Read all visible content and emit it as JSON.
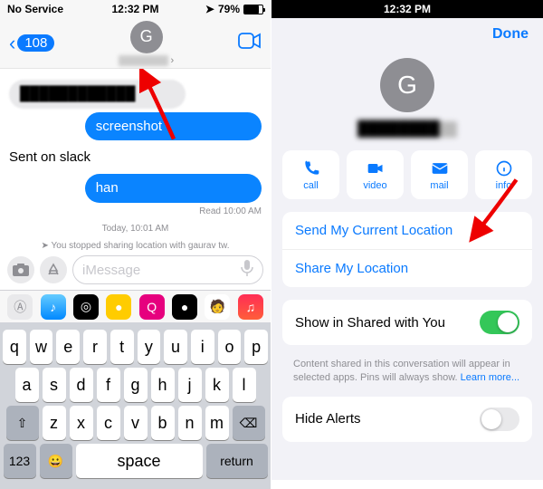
{
  "status": {
    "carrier": "No Service",
    "time": "12:32 PM",
    "pct": "79%"
  },
  "nav": {
    "badge": "108",
    "avatar_initial": "G",
    "contact": "████"
  },
  "messages": {
    "received_blur": "████████████",
    "sent1": "screenshot",
    "plain": "Sent on slack",
    "sent2": "han",
    "read": "Read 10:00 AM",
    "sys_time": "Today, 10:01 AM",
    "sys_text": "You stopped sharing location with gaurav tw."
  },
  "composer": {
    "placeholder": "iMessage"
  },
  "keys": {
    "r1": [
      "q",
      "w",
      "e",
      "r",
      "t",
      "y",
      "u",
      "i",
      "o",
      "p"
    ],
    "r2": [
      "a",
      "s",
      "d",
      "f",
      "g",
      "h",
      "j",
      "k",
      "l"
    ],
    "r3": [
      "z",
      "x",
      "c",
      "v",
      "b",
      "n",
      "m"
    ],
    "shift": "⇧",
    "back": "⌫",
    "num": "123",
    "space": "space",
    "ret": "return"
  },
  "sheet": {
    "done": "Done",
    "avatar_initial": "G",
    "name": "████████",
    "actions": {
      "call": "call",
      "video": "video",
      "mail": "mail",
      "info": "info"
    },
    "send_loc": "Send My Current Location",
    "share_loc": "Share My Location",
    "show_shared": "Show in Shared with You",
    "help": "Content shared in this conversation will appear in selected apps. Pins will always show. ",
    "learn": "Learn more...",
    "hide_alerts": "Hide Alerts"
  }
}
